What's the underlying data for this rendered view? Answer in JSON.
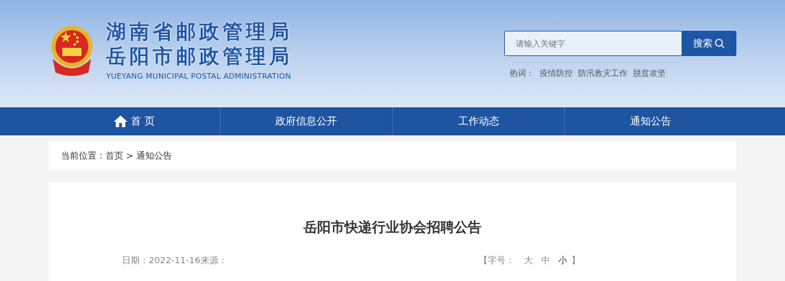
{
  "header": {
    "title_province": "湖南省邮政管理局",
    "title_city": "岳阳市邮政管理局",
    "title_english": "YUEYANG  MUNICIPAL POSTAL ADMINISTRATION"
  },
  "search": {
    "placeholder": "请输入关键字",
    "button": "搜索"
  },
  "hot_words": {
    "label": "热词：",
    "items": [
      "疫情防控",
      "防汛救灾工作",
      "脱贫攻坚"
    ]
  },
  "nav": [
    {
      "label": "首 页",
      "kind": "home"
    },
    {
      "label": "政府信息公开",
      "kind": "plain"
    },
    {
      "label": "工作动态",
      "kind": "plain"
    },
    {
      "label": "通知公告",
      "kind": "plain"
    }
  ],
  "breadcrumb": {
    "label": "当前位置：",
    "items": [
      "首页",
      "通知公告"
    ],
    "separator": ">"
  },
  "article": {
    "title": "岳阳市快递行业协会招聘公告",
    "meta": "日期：2022-11-16来源：",
    "font_size": {
      "open": "【字号：",
      "close": "】",
      "options": [
        {
          "label": "大",
          "selected": false
        },
        {
          "label": "中",
          "selected": false
        },
        {
          "label": "小",
          "selected": true
        }
      ]
    }
  }
}
